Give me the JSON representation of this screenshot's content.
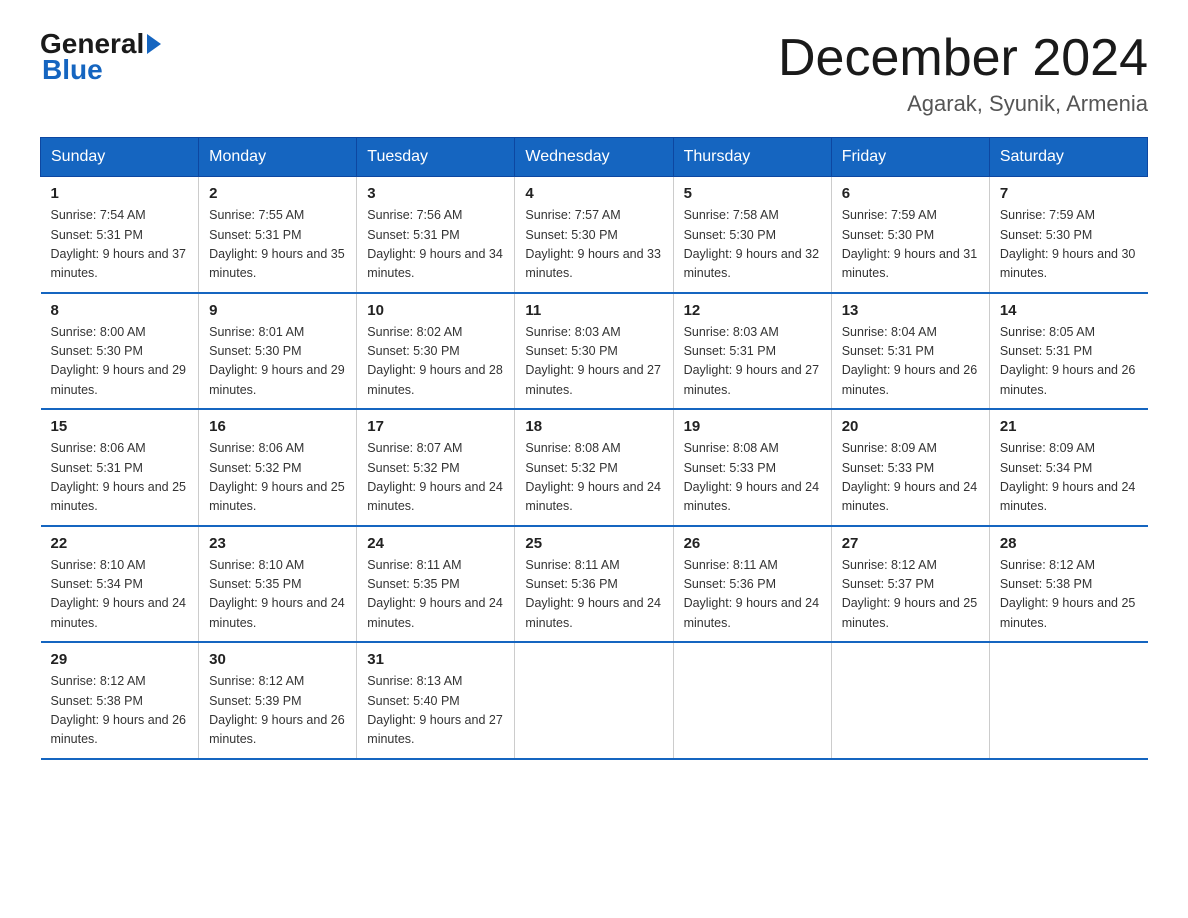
{
  "header": {
    "logo_general": "General",
    "logo_blue": "Blue",
    "month_title": "December 2024",
    "subtitle": "Agarak, Syunik, Armenia"
  },
  "days_of_week": [
    "Sunday",
    "Monday",
    "Tuesday",
    "Wednesday",
    "Thursday",
    "Friday",
    "Saturday"
  ],
  "weeks": [
    [
      {
        "day": "1",
        "sunrise": "7:54 AM",
        "sunset": "5:31 PM",
        "daylight": "9 hours and 37 minutes."
      },
      {
        "day": "2",
        "sunrise": "7:55 AM",
        "sunset": "5:31 PM",
        "daylight": "9 hours and 35 minutes."
      },
      {
        "day": "3",
        "sunrise": "7:56 AM",
        "sunset": "5:31 PM",
        "daylight": "9 hours and 34 minutes."
      },
      {
        "day": "4",
        "sunrise": "7:57 AM",
        "sunset": "5:30 PM",
        "daylight": "9 hours and 33 minutes."
      },
      {
        "day": "5",
        "sunrise": "7:58 AM",
        "sunset": "5:30 PM",
        "daylight": "9 hours and 32 minutes."
      },
      {
        "day": "6",
        "sunrise": "7:59 AM",
        "sunset": "5:30 PM",
        "daylight": "9 hours and 31 minutes."
      },
      {
        "day": "7",
        "sunrise": "7:59 AM",
        "sunset": "5:30 PM",
        "daylight": "9 hours and 30 minutes."
      }
    ],
    [
      {
        "day": "8",
        "sunrise": "8:00 AM",
        "sunset": "5:30 PM",
        "daylight": "9 hours and 29 minutes."
      },
      {
        "day": "9",
        "sunrise": "8:01 AM",
        "sunset": "5:30 PM",
        "daylight": "9 hours and 29 minutes."
      },
      {
        "day": "10",
        "sunrise": "8:02 AM",
        "sunset": "5:30 PM",
        "daylight": "9 hours and 28 minutes."
      },
      {
        "day": "11",
        "sunrise": "8:03 AM",
        "sunset": "5:30 PM",
        "daylight": "9 hours and 27 minutes."
      },
      {
        "day": "12",
        "sunrise": "8:03 AM",
        "sunset": "5:31 PM",
        "daylight": "9 hours and 27 minutes."
      },
      {
        "day": "13",
        "sunrise": "8:04 AM",
        "sunset": "5:31 PM",
        "daylight": "9 hours and 26 minutes."
      },
      {
        "day": "14",
        "sunrise": "8:05 AM",
        "sunset": "5:31 PM",
        "daylight": "9 hours and 26 minutes."
      }
    ],
    [
      {
        "day": "15",
        "sunrise": "8:06 AM",
        "sunset": "5:31 PM",
        "daylight": "9 hours and 25 minutes."
      },
      {
        "day": "16",
        "sunrise": "8:06 AM",
        "sunset": "5:32 PM",
        "daylight": "9 hours and 25 minutes."
      },
      {
        "day": "17",
        "sunrise": "8:07 AM",
        "sunset": "5:32 PM",
        "daylight": "9 hours and 24 minutes."
      },
      {
        "day": "18",
        "sunrise": "8:08 AM",
        "sunset": "5:32 PM",
        "daylight": "9 hours and 24 minutes."
      },
      {
        "day": "19",
        "sunrise": "8:08 AM",
        "sunset": "5:33 PM",
        "daylight": "9 hours and 24 minutes."
      },
      {
        "day": "20",
        "sunrise": "8:09 AM",
        "sunset": "5:33 PM",
        "daylight": "9 hours and 24 minutes."
      },
      {
        "day": "21",
        "sunrise": "8:09 AM",
        "sunset": "5:34 PM",
        "daylight": "9 hours and 24 minutes."
      }
    ],
    [
      {
        "day": "22",
        "sunrise": "8:10 AM",
        "sunset": "5:34 PM",
        "daylight": "9 hours and 24 minutes."
      },
      {
        "day": "23",
        "sunrise": "8:10 AM",
        "sunset": "5:35 PM",
        "daylight": "9 hours and 24 minutes."
      },
      {
        "day": "24",
        "sunrise": "8:11 AM",
        "sunset": "5:35 PM",
        "daylight": "9 hours and 24 minutes."
      },
      {
        "day": "25",
        "sunrise": "8:11 AM",
        "sunset": "5:36 PM",
        "daylight": "9 hours and 24 minutes."
      },
      {
        "day": "26",
        "sunrise": "8:11 AM",
        "sunset": "5:36 PM",
        "daylight": "9 hours and 24 minutes."
      },
      {
        "day": "27",
        "sunrise": "8:12 AM",
        "sunset": "5:37 PM",
        "daylight": "9 hours and 25 minutes."
      },
      {
        "day": "28",
        "sunrise": "8:12 AM",
        "sunset": "5:38 PM",
        "daylight": "9 hours and 25 minutes."
      }
    ],
    [
      {
        "day": "29",
        "sunrise": "8:12 AM",
        "sunset": "5:38 PM",
        "daylight": "9 hours and 26 minutes."
      },
      {
        "day": "30",
        "sunrise": "8:12 AM",
        "sunset": "5:39 PM",
        "daylight": "9 hours and 26 minutes."
      },
      {
        "day": "31",
        "sunrise": "8:13 AM",
        "sunset": "5:40 PM",
        "daylight": "9 hours and 27 minutes."
      },
      null,
      null,
      null,
      null
    ]
  ]
}
